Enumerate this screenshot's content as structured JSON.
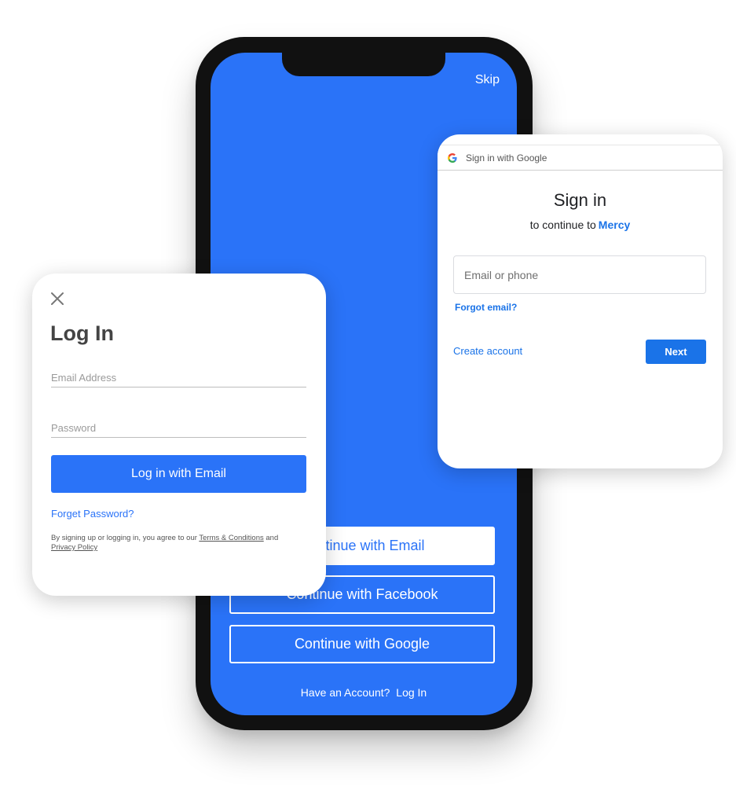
{
  "colors": {
    "brand_blue": "#2a73f8",
    "google_blue": "#1a73e8",
    "phone_frame": "#111111"
  },
  "phone": {
    "skip_label": "Skip",
    "buttons": [
      {
        "label": "Continue with Email",
        "style": "filled"
      },
      {
        "label": "Continue with Facebook",
        "style": "outline"
      },
      {
        "label": "Continue with Google",
        "style": "outline"
      }
    ],
    "have_account_text": "Have an Account?",
    "login_link_label": "Log In"
  },
  "login_card": {
    "close_icon": "close-icon",
    "title": "Log In",
    "email_placeholder": "Email Address",
    "password_placeholder": "Password",
    "submit_label": "Log in with Email",
    "forget_password_label": "Forget Password?",
    "legal": {
      "prefix": "By signing up or logging in, you agree to our",
      "terms_label": "Terms & Conditions",
      "and": "and",
      "privacy_label": "Privacy Policy"
    }
  },
  "google_card": {
    "header_icon": "google-logo-icon",
    "header_text": "Sign in with Google",
    "title": "Sign in",
    "subtitle_prefix": "to continue to",
    "app_name": "Mercy",
    "input_placeholder": "Email or phone",
    "forgot_email_label": "Forgot email?",
    "create_account_label": "Create account",
    "next_label": "Next"
  }
}
